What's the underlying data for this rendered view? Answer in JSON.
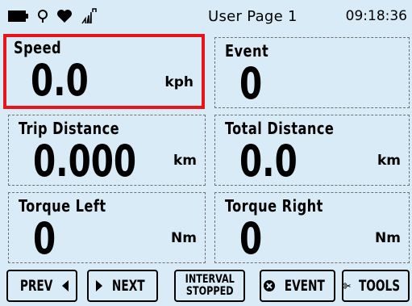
{
  "status_bar": {
    "icons": [
      "battery-icon",
      "gps-location-icon",
      "heart-icon",
      "power-meter-icon"
    ],
    "page_title": "User Page 1",
    "time": "09:18:36"
  },
  "tiles": [
    {
      "label": "Speed",
      "value": "0.0",
      "unit": "kph",
      "selected": true
    },
    {
      "label": "Event",
      "value": "0",
      "unit": ""
    },
    {
      "label": "Trip Distance",
      "value": "0.000",
      "unit": "km"
    },
    {
      "label": "Total Distance",
      "value": "0.0",
      "unit": "km"
    },
    {
      "label": "Torque Left",
      "value": "0",
      "unit": "Nm"
    },
    {
      "label": "Torque Right",
      "value": "0",
      "unit": "Nm"
    }
  ],
  "toolbar": {
    "prev_label": "PREV",
    "next_label": "NEXT",
    "interval_line1": "INTERVAL",
    "interval_line2": "STOPPED",
    "event_label": "EVENT",
    "tools_label": "TOOLS"
  },
  "colors": {
    "background": "#d8ebf6",
    "selection": "#e8141b"
  }
}
